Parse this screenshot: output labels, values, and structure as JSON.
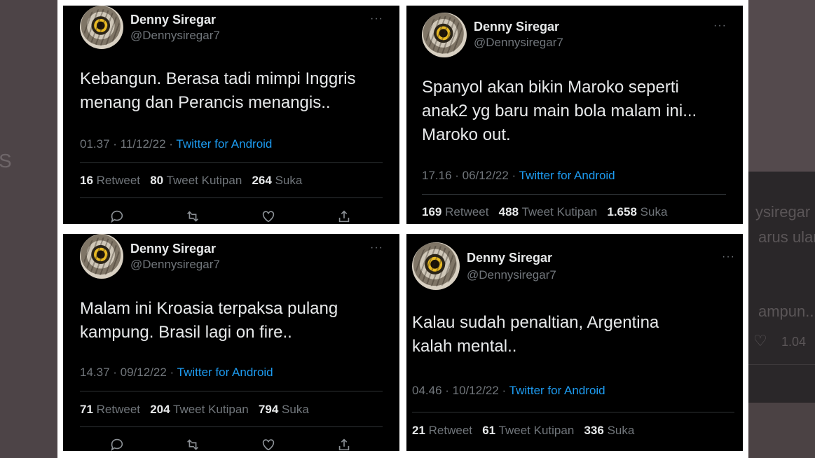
{
  "background": {
    "left_fragment": "S",
    "right_fragments": [
      "ysiregar",
      "arus ular",
      "ampun..",
      "1.04"
    ]
  },
  "tweets": [
    {
      "name": "Denny Siregar",
      "handle": "@Dennysiregar7",
      "more": "···",
      "text": "Kebangun. Berasa tadi mimpi Inggris\nmenang dan Perancis menangis..",
      "time": "01.37 · 11/12/22 · ",
      "source": "Twitter for Android",
      "retweets": "16",
      "retweet_label": "Retweet",
      "quotes": "80",
      "quote_label": "Tweet Kutipan",
      "likes": "264",
      "like_label": "Suka"
    },
    {
      "name": "Denny Siregar",
      "handle": "@Dennysiregar7",
      "more": "···",
      "text": "Spanyol akan bikin Maroko seperti\nanak2 yg baru main bola malam ini...\nMaroko out.",
      "time": "17.16 · 06/12/22 · ",
      "source": "Twitter for Android",
      "retweets": "169",
      "retweet_label": "Retweet",
      "quotes": "488",
      "quote_label": "Tweet Kutipan",
      "likes": "1.658",
      "like_label": "Suka"
    },
    {
      "name": "Denny Siregar",
      "handle": "@Dennysiregar7",
      "more": "···",
      "text": "Malam ini Kroasia terpaksa pulang\nkampung. Brasil lagi on fire..",
      "time": "14.37 · 09/12/22 · ",
      "source": "Twitter for Android",
      "retweets": "71",
      "retweet_label": "Retweet",
      "quotes": "204",
      "quote_label": "Tweet Kutipan",
      "likes": "794",
      "like_label": "Suka"
    },
    {
      "name": "Denny Siregar",
      "handle": "@Dennysiregar7",
      "more": "···",
      "text": "Kalau sudah penaltian, Argentina\nkalah mental..",
      "time": "04.46 · 10/12/22 · ",
      "source": "Twitter for Android",
      "retweets": "21",
      "retweet_label": "Retweet",
      "quotes": "61",
      "quote_label": "Tweet Kutipan",
      "likes": "336",
      "like_label": "Suka"
    }
  ]
}
